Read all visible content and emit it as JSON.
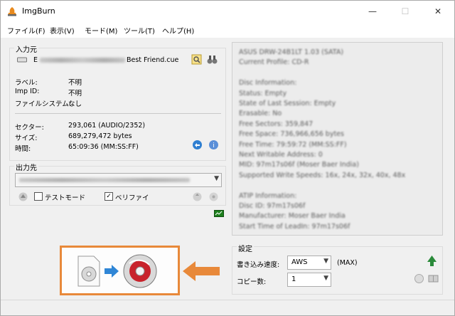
{
  "window": {
    "title": "ImgBurn",
    "minimize": "—",
    "maximize": "☐",
    "close": "✕"
  },
  "menu": [
    {
      "label": "ファイル(F)"
    },
    {
      "label": "表示(V)"
    },
    {
      "label": "モード(M)"
    },
    {
      "label": "ツール(T)"
    },
    {
      "label": "ヘルプ(H)"
    }
  ],
  "source": {
    "title": "入力元",
    "file_prefix": "E",
    "file_suffix": "Best Friend.cue",
    "rows": [
      {
        "label": "ラベル:",
        "value": "不明"
      },
      {
        "label": "Imp ID:",
        "value": "不明"
      },
      {
        "label": "ファイルシステム:",
        "value": "なし"
      }
    ],
    "stats": [
      {
        "label": "セクター:",
        "value": "293,061 (AUDIO/2352)"
      },
      {
        "label": "サイズ:",
        "value": "689,279,472 bytes"
      },
      {
        "label": "時間:",
        "value": "65:09:36 (MM:SS:FF)"
      }
    ]
  },
  "dest": {
    "title": "出力先",
    "test_mode": "テストモード",
    "test_mode_checked": false,
    "verify": "ベリファイ",
    "verify_checked": true
  },
  "info": {
    "lines": [
      "ASUS DRW-24B1LT 1.03 (SATA)",
      "Current Profile: CD-R",
      "",
      "Disc Information:",
      "Status: Empty",
      "State of Last Session: Empty",
      "Erasable: No",
      "Free Sectors: 359,847",
      "Free Space: 736,966,656 bytes",
      "Free Time: 79:59:72 (MM:SS:FF)",
      "Next Writable Address: 0",
      "MID: 97m17s06f (Moser Baer India)",
      "Supported Write Speeds: 16x, 24x, 32x, 40x, 48x",
      "",
      "ATIP Information:",
      "Disc ID: 97m17s06f",
      "Manufacturer: Moser Baer India",
      "Start Time of LeadIn: 97m17s06f"
    ]
  },
  "settings": {
    "title": "設定",
    "speed_label": "書き込み速度:",
    "speed_value": "AWS",
    "speed_max": "(MAX)",
    "copies_label": "コピー数:",
    "copies_value": "1"
  },
  "colors": {
    "accent_orange": "#e8893a",
    "burn_red": "#c8232c"
  }
}
